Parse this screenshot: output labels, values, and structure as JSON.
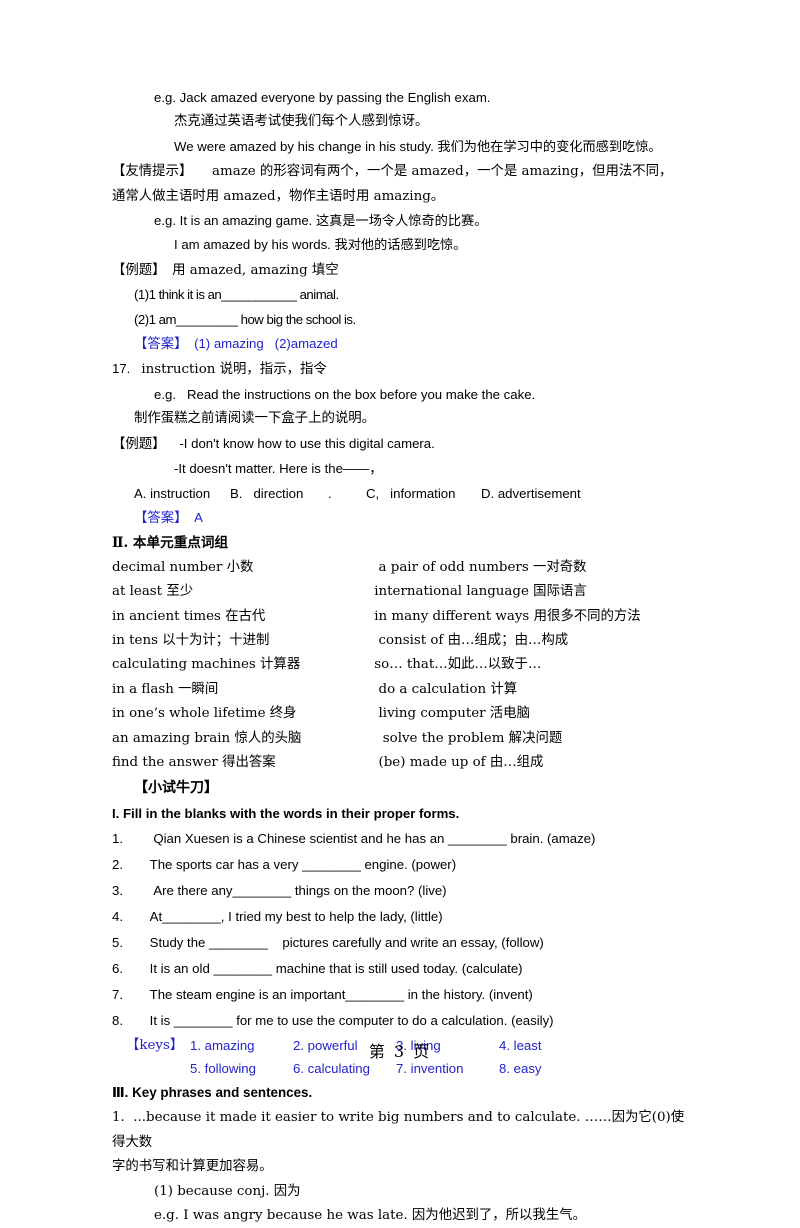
{
  "document": {
    "footer_page_label": "第 3 页"
  },
  "section_amaze": {
    "eg1_en": "e.g. Jack amazed everyone by passing the English exam.",
    "eg1_cn": "杰克通过英语考试使我们每个人感到惊讶。",
    "eg2": "We were amazed by his change in his study. 我们为他在学习中的变化而感到吃惊。",
    "tip_label": "【友情提示】",
    "tip_line1": "amaze 的形容词有两个，一个是 amazed，一个是 amazing，但用法不同，",
    "tip_line2": "通常人做主语时用 amazed，物作主语时用 amazing。",
    "eg3": "e.g. It is an amazing game. 这真是一场令人惊奇的比赛。",
    "eg4": "I am amazed by his words. 我对他的话感到吃惊。",
    "example_label": "【例题】",
    "example_instruction": "用 amazed, amazing 填空",
    "q1": "(1)1 think it is an___________ animal.",
    "q2": "(2)1 am_________ how big the school is.",
    "answer_label": "【答案】",
    "answer_text": "(1) amazing   (2)amazed"
  },
  "section_instruction": {
    "number": "17.",
    "headword": "instruction 说明，指示，指令",
    "eg_en": "e.g.   Read the instructions on the box before you make the cake.",
    "eg_cn": "制作蛋糕之前请阅读一下盒子上的说明。",
    "example_label": "【例题】",
    "dialog_line1": "-I don't know how to use this digital camera.",
    "dialog_line2": "-It doesn't matter. Here is the——，",
    "options": [
      "A. instruction",
      "B.   direction",
      ".",
      "C,   information",
      "D. advertisement"
    ],
    "answer_label": "【答案】",
    "answer_text": "A"
  },
  "section_phrases": {
    "heading": "Ⅱ. 本单元重点词组",
    "rows": [
      {
        "left": "decimal number 小数",
        "right": "  a pair of odd numbers 一对奇数"
      },
      {
        "left": "at least 至少",
        "right": " international language 国际语言"
      },
      {
        "left": "in ancient times 在古代",
        "right": " in many different ways 用很多不同的方法"
      },
      {
        "left": "in tens 以十为计；十进制",
        "right": "  consist of 由…组成；由…构成"
      },
      {
        "left": "calculating machines 计算器",
        "right": " so… that…如此…以致于…"
      },
      {
        "left": "in a flash 一瞬间",
        "right": "  do a calculation 计算"
      },
      {
        "left": "in one’s whole lifetime 终身",
        "right": "  living computer 活电脑"
      },
      {
        "left": "an amazing brain 惊人的头脑",
        "right": "   solve the problem 解决问题"
      },
      {
        "left": "find the answer 得出答案",
        "right": "  (be) made up of 由…组成"
      }
    ]
  },
  "section_practice": {
    "heading": "【小试牛刀】",
    "subheading": "I. Fill in the blanks with the words in their proper forms.",
    "items": [
      {
        "num": "1.",
        "text": "  Qian Xuesen is a Chinese scientist and he has an ________ brain. (amaze)"
      },
      {
        "num": "2.",
        "text": " The sports car has a very ________ engine. (power)"
      },
      {
        "num": "3.",
        "text": "  Are there any________ things on the moon? (live)"
      },
      {
        "num": "4.",
        "text": " At________, I tried my best to help the lady, (little)"
      },
      {
        "num": "5.",
        "text": " Study the ________    pictures carefully and write an essay, (follow)"
      },
      {
        "num": "6.",
        "text": " It is an old ________ machine that is still used today. (calculate)"
      },
      {
        "num": "7.",
        "text": " The steam engine is an important________ in the history. (invent)"
      },
      {
        "num": "8.",
        "text": " It is ________ for me to use the computer to do a calculation. (easily)"
      }
    ],
    "keys_label": "【keys】",
    "keys_row1": [
      "1. amazing",
      "2. powerful",
      "3. living",
      "4. least"
    ],
    "keys_row2": [
      "5. following",
      "6. calculating",
      "7. invention",
      "8. easy"
    ]
  },
  "section_key_phrases": {
    "heading": "Ⅲ. Key phrases and sentences.",
    "item1_line1": "1.  ...because it made it easier to write big numbers and to calculate. ……因为它(0)使得大数",
    "item1_line2": "字的书写和计算更加容易。",
    "sub1": "(1) because conj. 因为",
    "sub1_eg": "e.g. I was angry because he was late. 因为他迟到了，所以我生气。"
  },
  "colors": {
    "answer_blue": "#2222cc",
    "text_black": "#000000",
    "page_background": "#ffffff"
  }
}
